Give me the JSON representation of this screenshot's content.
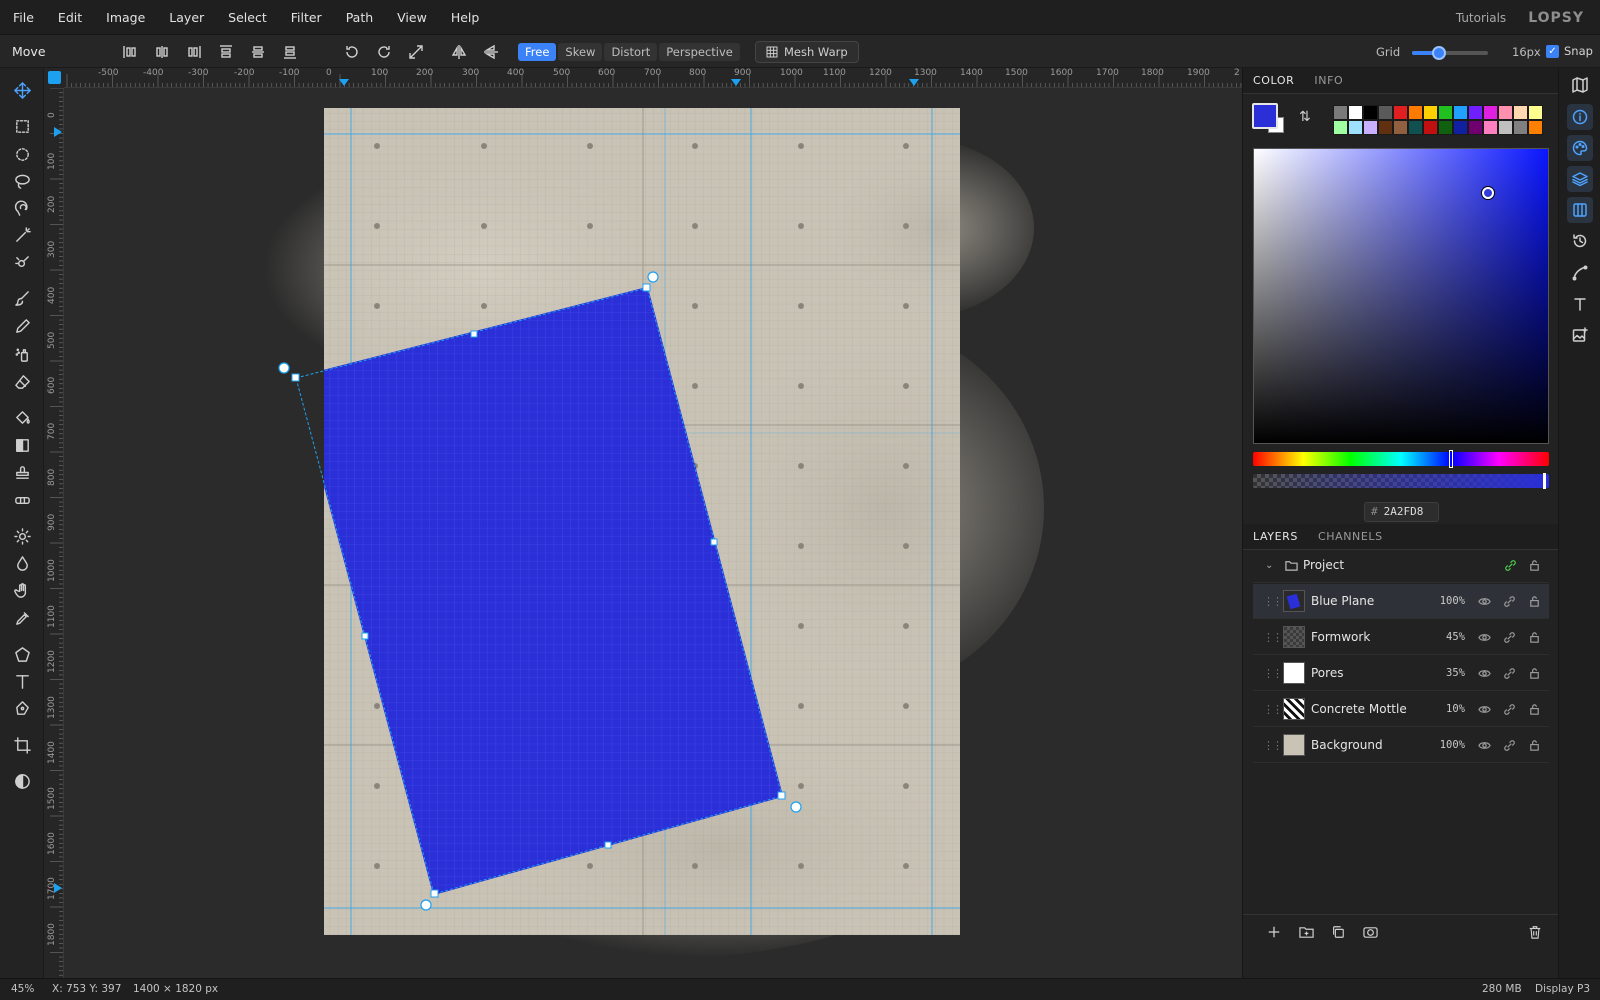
{
  "menubar": {
    "items": [
      "File",
      "Edit",
      "Image",
      "Layer",
      "Select",
      "Filter",
      "Path",
      "View",
      "Help"
    ],
    "tutorials": "Tutorials",
    "logo": "LOPSY"
  },
  "options": {
    "tool_name": "Move",
    "transform_modes": [
      "Free",
      "Skew",
      "Distort",
      "Perspective"
    ],
    "active_mode": "Free",
    "mesh_warp": "Mesh Warp",
    "grid_label": "Grid",
    "grid_value": "16px",
    "grid_slider_fraction": 0.35,
    "snap_label": "Snap",
    "snap_checked": true
  },
  "rulers": {
    "h_ticks": [
      "-500",
      "-400",
      "-300",
      "-200",
      "-100",
      "0",
      "100",
      "200",
      "300",
      "400",
      "500",
      "600",
      "700",
      "800",
      "900",
      "1000",
      "1100",
      "1200",
      "1300",
      "1400",
      "1500",
      "1600",
      "1700",
      "1800",
      "1900",
      "2"
    ],
    "v_ticks": [
      "0",
      "100",
      "200",
      "300",
      "400",
      "500",
      "600",
      "700",
      "800",
      "900",
      "1000",
      "1100",
      "1200",
      "1300",
      "1400",
      "1500",
      "1600",
      "1700",
      "1800"
    ]
  },
  "color_panel": {
    "tabs": [
      "COLOR",
      "INFO"
    ],
    "active_tab": "COLOR",
    "foreground": "#2A2FD8",
    "background": "#FFFFFF",
    "hex_label": "#",
    "hex_value": "2A2FD8",
    "swatches": [
      "#7a7a7a",
      "#ffffff",
      "#000000",
      "#5a5a5a",
      "#e02020",
      "#ff7a00",
      "#ffd000",
      "#20c020",
      "#20a0ff",
      "#7020ff",
      "#e020e0",
      "#ff90b0",
      "#ffd8b0",
      "#ffff90",
      "#a0ffa0",
      "#a0e0ff",
      "#c8b0ff",
      "#603010",
      "#906040",
      "#105050",
      "#c01010",
      "#106010",
      "#1020a0",
      "#700070",
      "#ff80c0",
      "#c0c0c0",
      "#808080",
      "#ff8000"
    ]
  },
  "layers_panel": {
    "tabs": [
      "LAYERS",
      "CHANNELS"
    ],
    "active_tab": "LAYERS",
    "group": "Project",
    "layers": [
      {
        "name": "Blue Plane",
        "opacity": "100%",
        "selected": true
      },
      {
        "name": "Formwork",
        "opacity": "45%",
        "selected": false
      },
      {
        "name": "Pores",
        "opacity": "35%",
        "selected": false
      },
      {
        "name": "Concrete Mottle",
        "opacity": "10%",
        "selected": false
      },
      {
        "name": "Background",
        "opacity": "100%",
        "selected": false
      }
    ]
  },
  "status": {
    "zoom": "45%",
    "coords": "X: 753  Y: 397",
    "dims": "1400 × 1820 px",
    "memory": "280 MB",
    "profile": "Display P3"
  },
  "colors": {
    "accent": "#3b82f6",
    "guide": "#1ea0f0",
    "plane": "#2A2FD8",
    "concrete": "#c9c3b6"
  }
}
